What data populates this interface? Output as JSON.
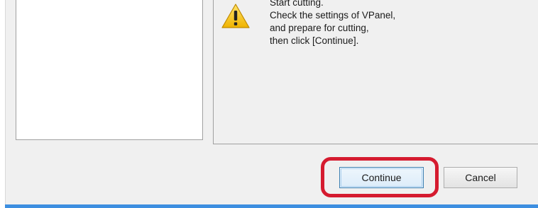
{
  "dialog": {
    "message_lines": [
      "Start cutting.",
      "Check the settings of VPanel,",
      "and prepare for cutting,",
      "then click [Continue]."
    ],
    "icon": "warning-icon",
    "buttons": {
      "continue_label": "Continue",
      "cancel_label": "Cancel"
    }
  },
  "colors": {
    "highlight": "#d51b2f",
    "accent": "#3c8ee0",
    "warning": "#f5c518"
  }
}
